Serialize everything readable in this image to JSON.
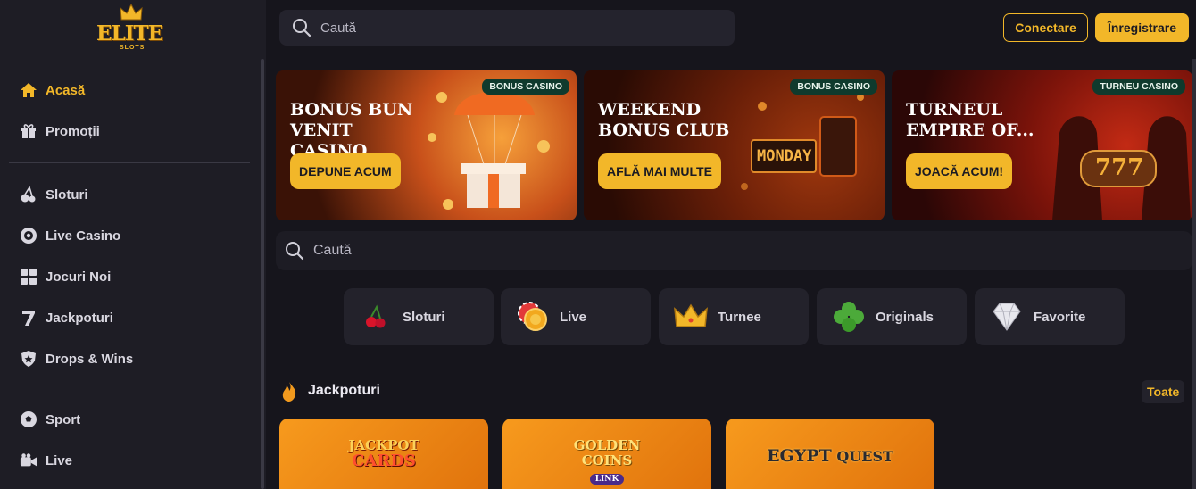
{
  "brand": {
    "logo_word": "ELITE",
    "logo_sub": "SLOTS"
  },
  "colors": {
    "accent": "#f2b729",
    "sidebar_bg": "#1e1d25",
    "page_bg": "#16151c",
    "badge_bg": "#0f3a2d"
  },
  "sidebar": {
    "items": [
      {
        "label": "Acasă",
        "icon": "home-icon"
      },
      {
        "label": "Promoții",
        "icon": "gift-icon"
      },
      {
        "label": "Sloturi",
        "icon": "cherry-icon"
      },
      {
        "label": "Live Casino",
        "icon": "roulette-icon"
      },
      {
        "label": "Jocuri Noi",
        "icon": "grid-icon"
      },
      {
        "label": "Jackpoturi",
        "icon": "seven-icon"
      },
      {
        "label": "Drops & Wins",
        "icon": "shield-icon"
      },
      {
        "label": "Sport",
        "icon": "soccer-ball-icon"
      },
      {
        "label": "Live",
        "icon": "video-icon"
      }
    ]
  },
  "header": {
    "search_placeholder": "Caută",
    "login_label": "Conectare",
    "register_label": "Înregistrare"
  },
  "banners": [
    {
      "title": "BONUS BUN VENIT CASINO",
      "badge": "BONUS CASINO",
      "cta": "DEPUNE ACUM"
    },
    {
      "title": "WEEKEND BONUS CLUB",
      "badge": "BONUS CASINO",
      "cta": "AFLĂ MAI MULTE",
      "art_text": "MONDAY"
    },
    {
      "title": "TURNEUL EMPIRE OF...",
      "badge": "TURNEU CASINO",
      "cta": "JOACĂ ACUM!",
      "art_text": "777"
    }
  ],
  "main_search_placeholder": "Caută",
  "categories": [
    {
      "label": "Sloturi",
      "icon": "cherry-icon"
    },
    {
      "label": "Live",
      "icon": "chip-icon"
    },
    {
      "label": "Turnee",
      "icon": "crown-icon"
    },
    {
      "label": "Originals",
      "icon": "clover-icon"
    },
    {
      "label": "Favorite",
      "icon": "diamond-icon"
    }
  ],
  "jackpot_section": {
    "title": "Jackpoturi",
    "see_all": "Toate",
    "games": [
      {
        "logo_line1": "JACKPOT",
        "logo_line2": "CARDS"
      },
      {
        "logo_line1": "GOLDEN",
        "logo_line2": "COINS",
        "logo_line3": "LINK"
      },
      {
        "logo_line1": "EGYPT",
        "logo_line2": "QUEST"
      }
    ]
  }
}
